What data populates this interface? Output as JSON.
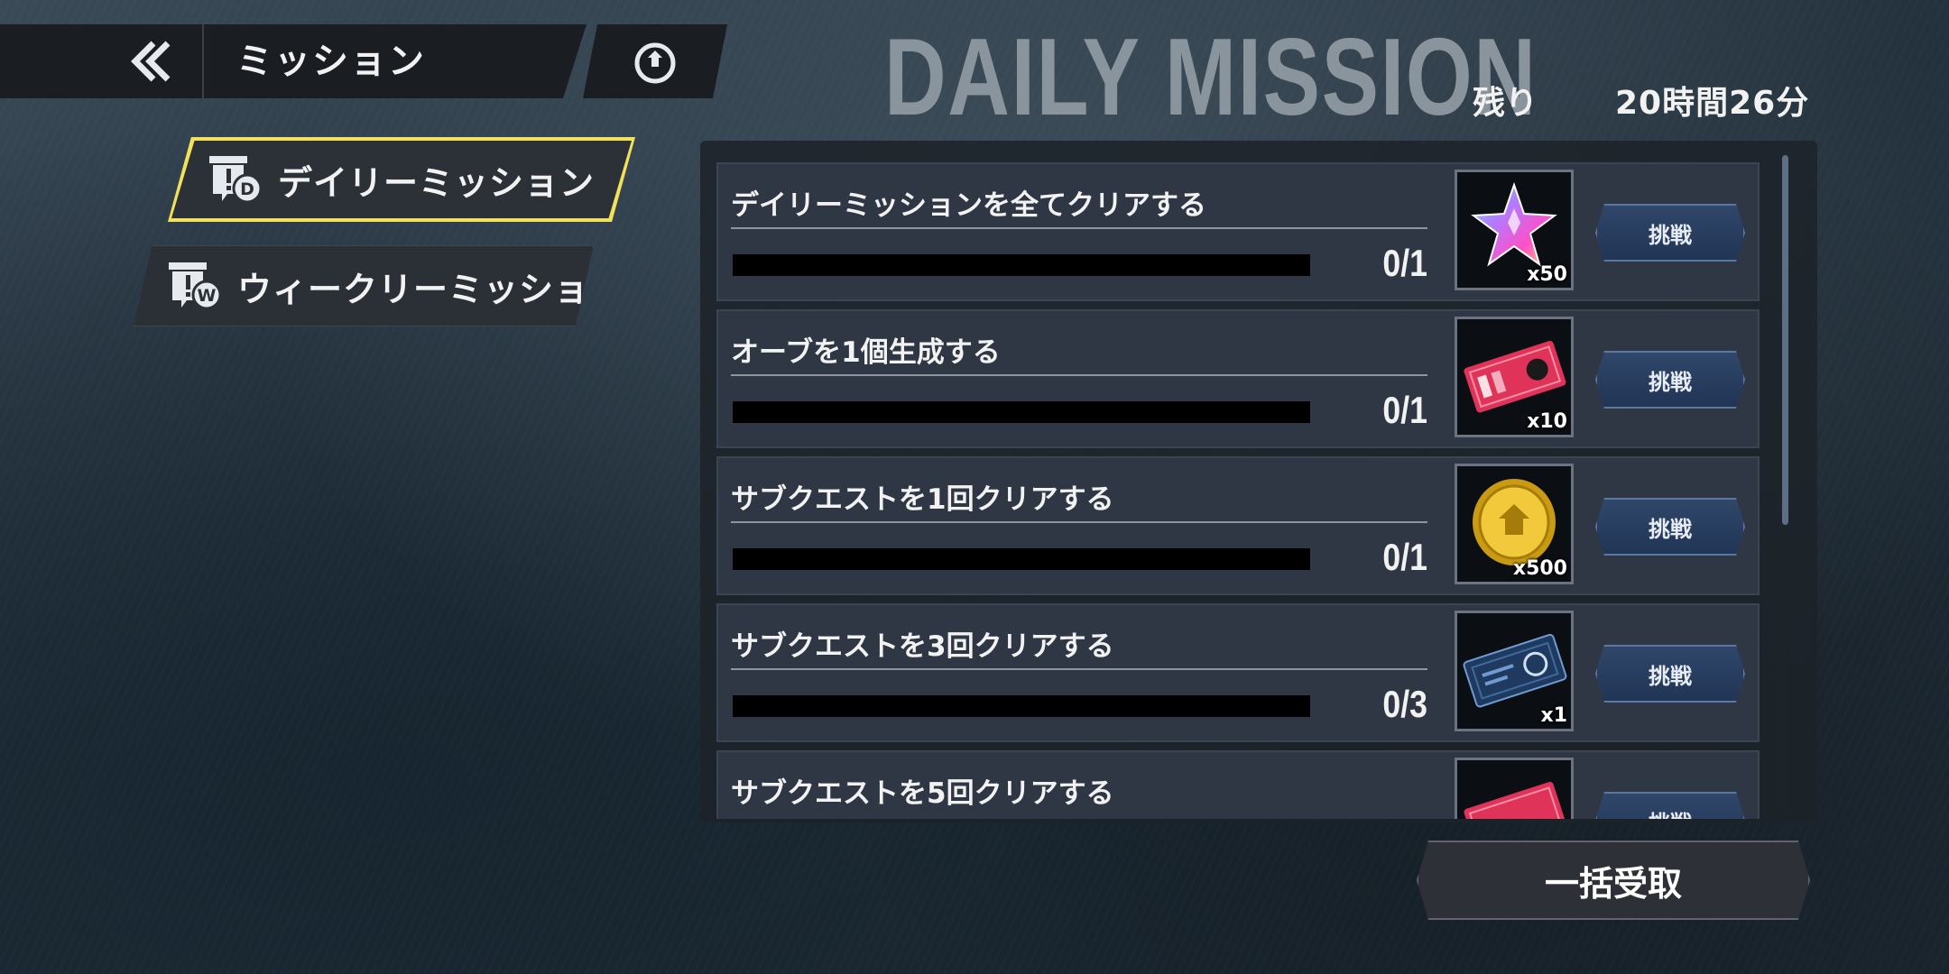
{
  "header": {
    "title": "ミッション",
    "back_icon": "double-chevron-left-icon",
    "badge_icon": "emblem-icon"
  },
  "page_title": "DAILY MISSION",
  "remaining": {
    "label": "残り",
    "value": "20時間26分"
  },
  "tabs": [
    {
      "label": "デイリーミッション",
      "icon": "mission-daily-icon",
      "icon_letter": "D",
      "selected": true
    },
    {
      "label": "ウィークリーミッション",
      "icon": "mission-weekly-icon",
      "icon_letter": "W",
      "selected": false
    }
  ],
  "missions": [
    {
      "title": "デイリーミッションを全てクリアする",
      "count": "0/1",
      "progress": 0,
      "reward_icon": "star-crystal-icon",
      "reward_qty": "x50",
      "button": "挑戦"
    },
    {
      "title": "オーブを1個生成する",
      "count": "0/1",
      "progress": 0,
      "reward_icon": "red-ticket-icon",
      "reward_qty": "x10",
      "button": "挑戦"
    },
    {
      "title": "サブクエストを1回クリアする",
      "count": "0/1",
      "progress": 0,
      "reward_icon": "gold-coin-icon",
      "reward_qty": "x500",
      "button": "挑戦"
    },
    {
      "title": "サブクエストを3回クリアする",
      "count": "0/3",
      "progress": 0,
      "reward_icon": "blue-ticket-icon",
      "reward_qty": "x1",
      "button": "挑戦"
    },
    {
      "title": "サブクエストを5回クリアする",
      "count": "",
      "progress": 0,
      "reward_icon": "red-ticket-icon",
      "reward_qty": "",
      "button": "挑戦"
    }
  ],
  "bulk_receive_label": "一括受取",
  "colors": {
    "selected_tab_border": "#f2e15a",
    "button_blue": "#2a3f60",
    "panel": "#2f3744"
  }
}
